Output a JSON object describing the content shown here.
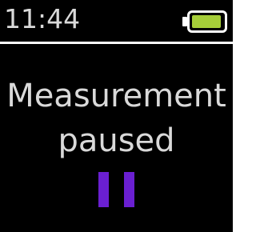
{
  "status_bar": {
    "time": "11:44",
    "battery": {
      "icon": "battery-icon",
      "level": 0.95,
      "fill_color": "#a6ce39"
    }
  },
  "main": {
    "message_line1": "Measurement",
    "message_line2": "paused",
    "status_icon": "pause-icon",
    "status_icon_color": "#6a1fd1"
  }
}
